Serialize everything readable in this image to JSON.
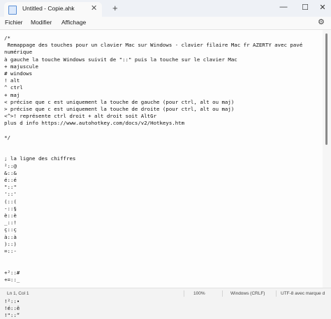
{
  "tab": {
    "title": "Untitled - Copie.ahk",
    "close_glyph": "✕"
  },
  "new_tab_glyph": "+",
  "window_controls": {
    "minimize": "—",
    "maximize": "☐",
    "close": "✕"
  },
  "menu": {
    "file": "Fichier",
    "edit": "Modifier",
    "view": "Affichage"
  },
  "settings_icon": "gear-icon",
  "settings_glyph": "⚙",
  "editor_content": "/*\n Remappage des touches pour un clavier Mac sur Windows - clavier filaire Mac fr AZERTY avec pavé\nnumérique\nà gauche la touche Windows suivit de \"::\" puis la touche sur le clavier Mac\n+ majuscule\n# windows\n! alt\n^ ctrl\n+ maj\n< précise que c est uniquement la touche de gauche (pour ctrl, alt ou maj)\n> précise que c est uniquement la touche de droite (pour ctrl, alt ou maj)\n<^>! représente ctrl droit + alt droit soit AltGr\nplus d info https://www.autohotkey.com/docs/v2/Hotkeys.htm\n\n*/\n\n\n; la ligne des chiffres\n²::@\n&::&\né::é\n\"::\"\n'::'\n(::(\n-::§\nè::è\n_::!\nç::ç\nà::à\n)::)\n=::-\n\n\n+²::#\n+=::_\n\n\n!²::•\n!é::ë\n!\"::“",
  "status": {
    "position": "Ln 1, Col 1",
    "zoom": "100%",
    "line_ending": "Windows (CRLF)",
    "encoding": "UTF-8 avec marque d"
  }
}
